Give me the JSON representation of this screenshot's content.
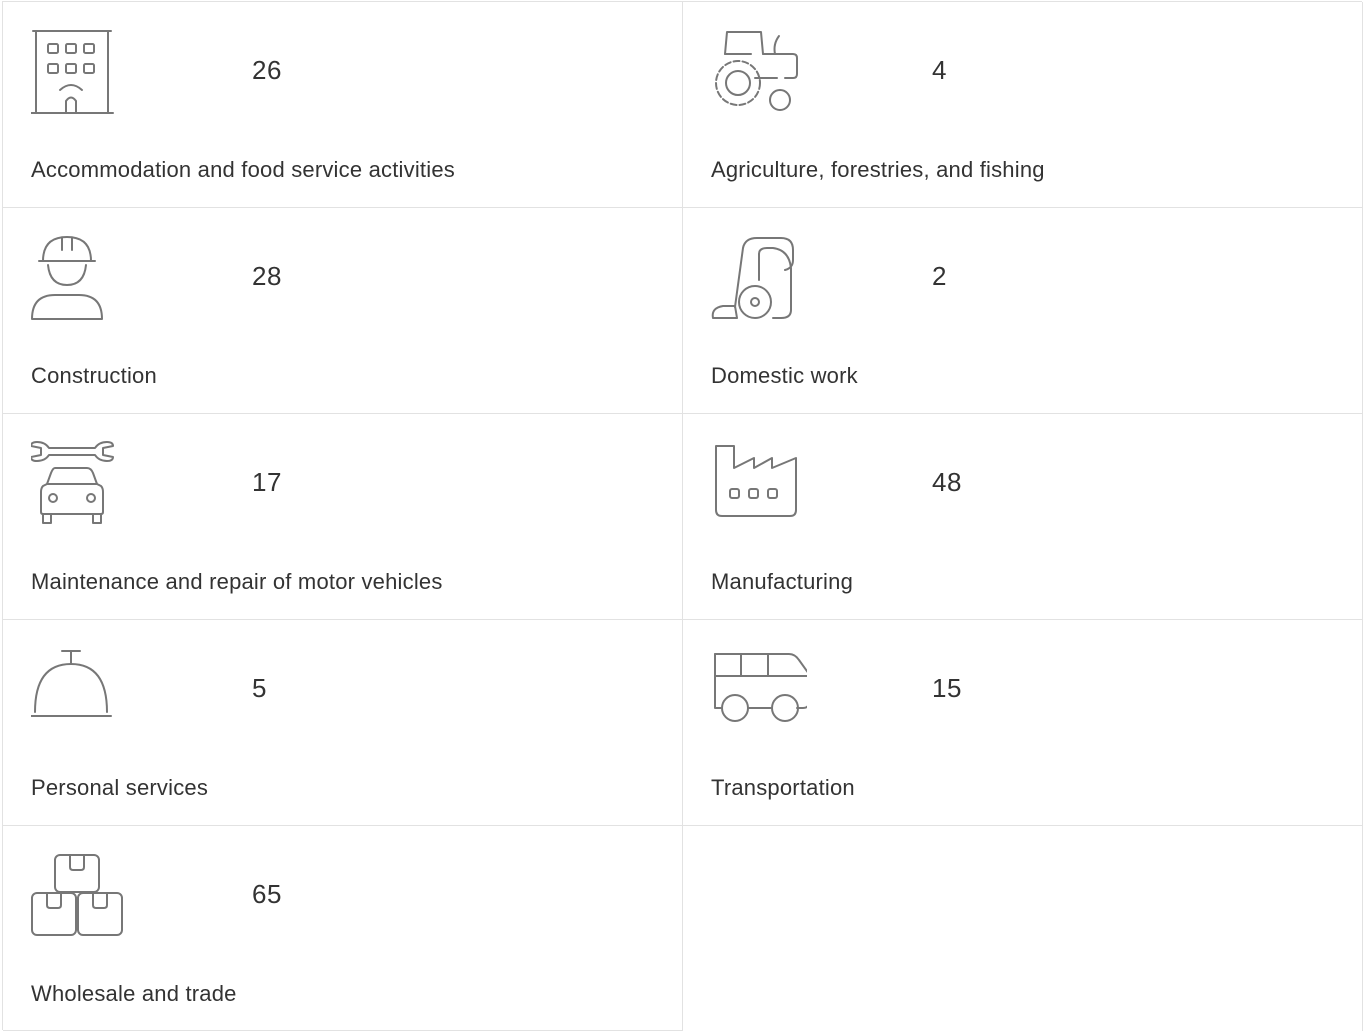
{
  "sectors": [
    {
      "count": "26",
      "label": "Accommodation and food service activities",
      "icon": "building-icon"
    },
    {
      "count": "4",
      "label": "Agriculture, forestries, and fishing",
      "icon": "tractor-icon"
    },
    {
      "count": "28",
      "label": "Construction",
      "icon": "construction-worker-icon"
    },
    {
      "count": "2",
      "label": "Domestic work",
      "icon": "vacuum-cleaner-icon"
    },
    {
      "count": "17",
      "label": "Maintenance and repair of motor vehicles",
      "icon": "car-repair-icon"
    },
    {
      "count": "48",
      "label": "Manufacturing",
      "icon": "factory-icon"
    },
    {
      "count": "5",
      "label": "Personal services",
      "icon": "service-bell-icon"
    },
    {
      "count": "15",
      "label": "Transportation",
      "icon": "van-icon"
    },
    {
      "count": "65",
      "label": "Wholesale and trade",
      "icon": "boxes-icon"
    }
  ],
  "colors": {
    "icon_stroke": "#777777",
    "text": "#333333",
    "border": "#e2e2e2"
  }
}
